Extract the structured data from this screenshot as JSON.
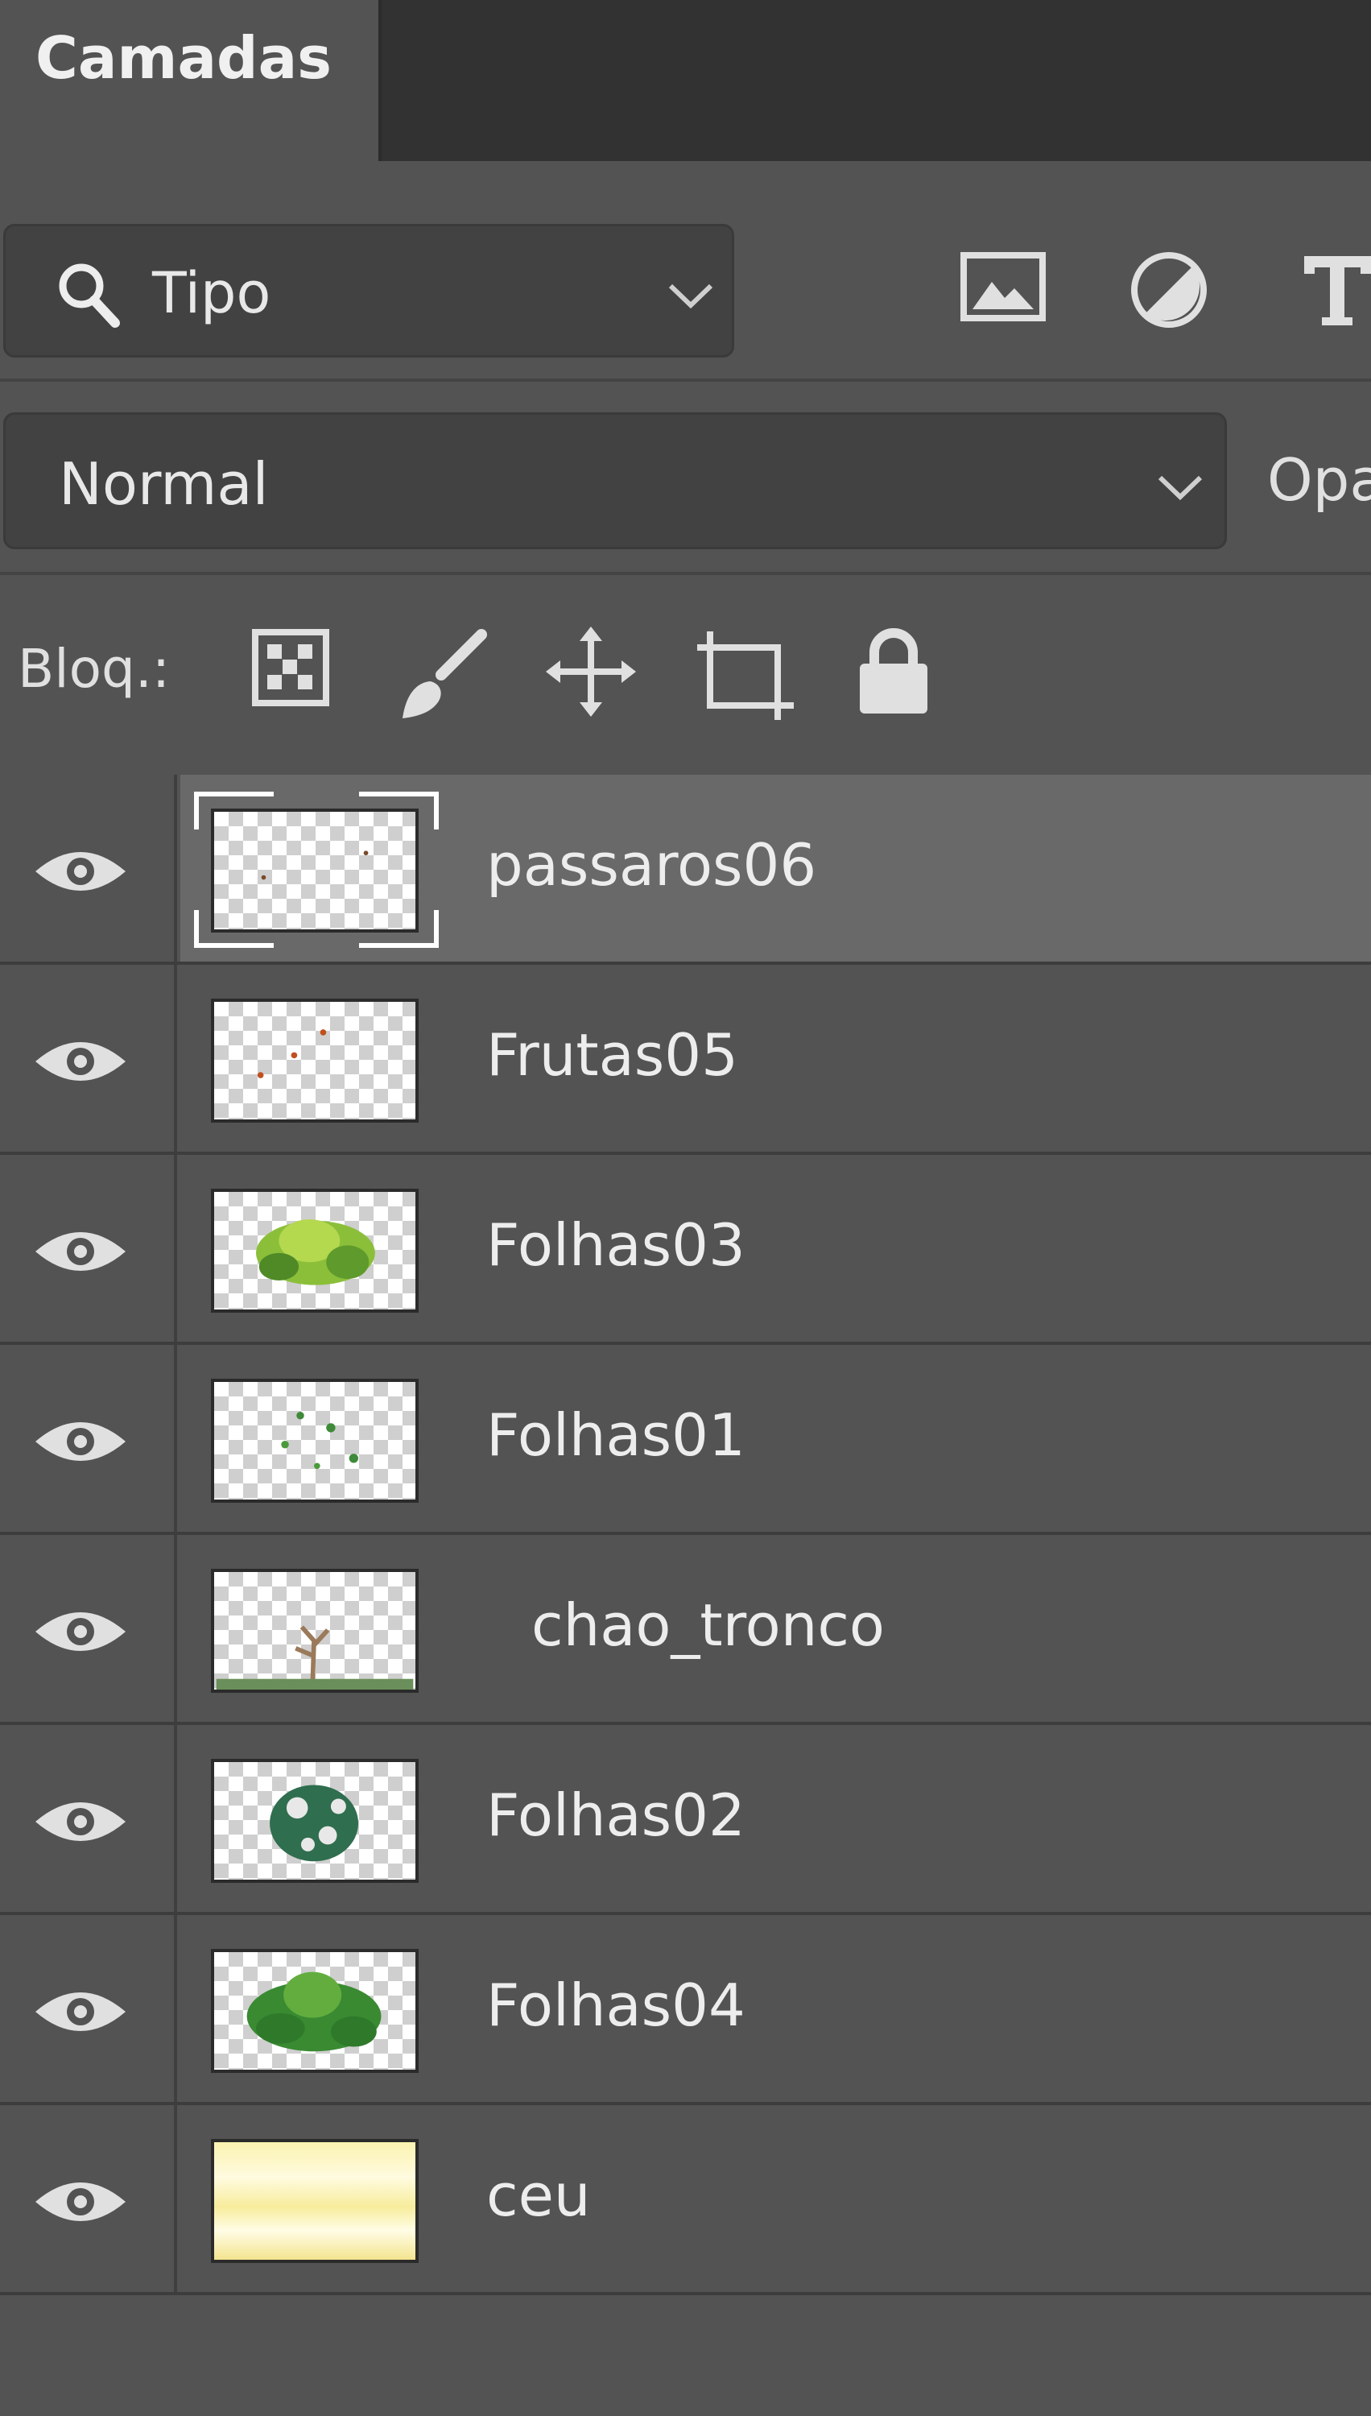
{
  "panel": {
    "tab_label": "Camadas"
  },
  "filter": {
    "selected_label": "Tipo",
    "icons": [
      "image-filter-icon",
      "adjustment-filter-icon",
      "type-filter-icon"
    ]
  },
  "blend": {
    "mode_label": "Normal",
    "opacity_label": "Opa"
  },
  "lock": {
    "label": "Bloq.:",
    "icons": [
      "lock-transparent-pixels-icon",
      "lock-image-pixels-icon",
      "lock-position-icon",
      "lock-artboard-icon",
      "lock-all-icon"
    ]
  },
  "layers": [
    {
      "name": "passaros06",
      "visible": true,
      "selected": true
    },
    {
      "name": "Frutas05",
      "visible": true,
      "selected": false
    },
    {
      "name": "Folhas03",
      "visible": true,
      "selected": false
    },
    {
      "name": "Folhas01",
      "visible": true,
      "selected": false
    },
    {
      "name": "chao_tronco",
      "visible": true,
      "selected": false
    },
    {
      "name": "Folhas02",
      "visible": true,
      "selected": false
    },
    {
      "name": "Folhas04",
      "visible": true,
      "selected": false
    },
    {
      "name": "ceu",
      "visible": true,
      "selected": false
    }
  ],
  "colors": {
    "panel_bg": "#535353",
    "selected_row": "#696969",
    "tab_bar": "#323232"
  }
}
